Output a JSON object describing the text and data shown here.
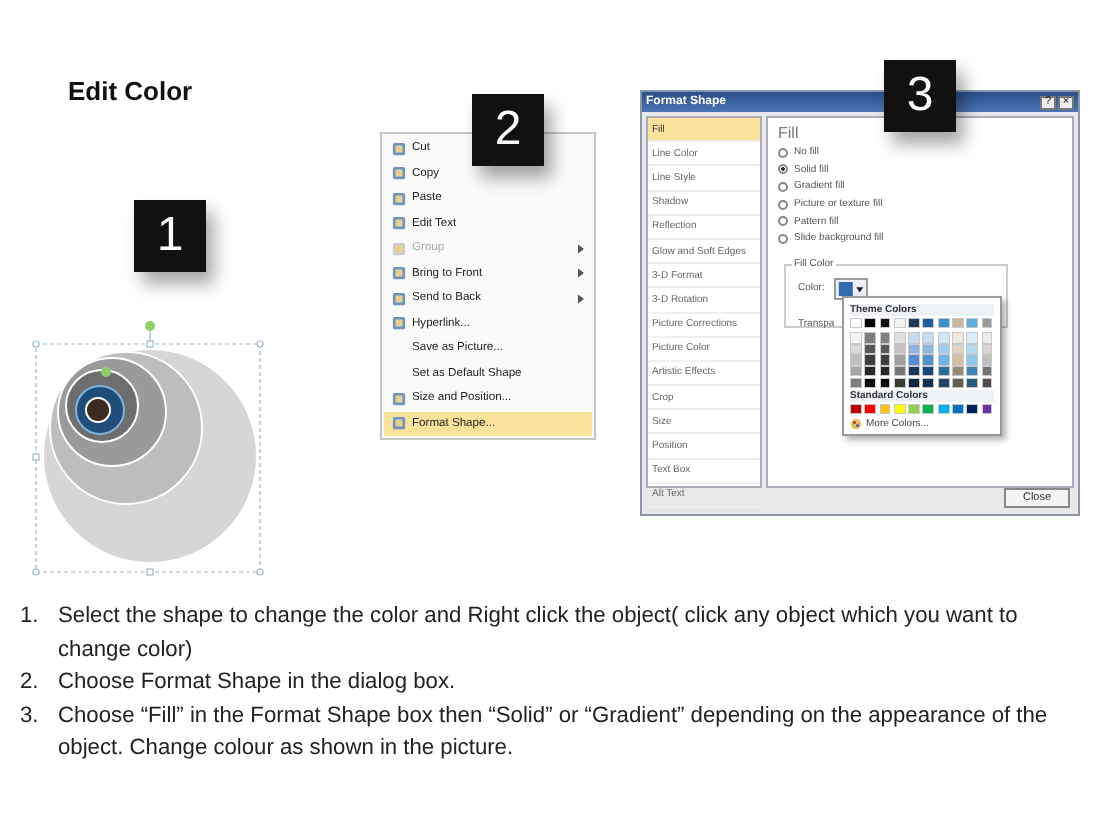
{
  "title": "Edit Color",
  "step_badges": [
    "1",
    "2",
    "3"
  ],
  "context_menu": {
    "items": [
      {
        "label": "Cut",
        "kind": "with-icon",
        "disabled": false,
        "submenu": false,
        "selected": false
      },
      {
        "label": "Copy",
        "kind": "with-icon",
        "disabled": false,
        "submenu": false,
        "selected": false
      },
      {
        "label": "Paste",
        "kind": "with-icon",
        "disabled": false,
        "submenu": false,
        "selected": false
      },
      {
        "label": "Edit Text",
        "kind": "with-icon",
        "disabled": false,
        "submenu": false,
        "selected": false
      },
      {
        "label": "Group",
        "kind": "with-icon",
        "disabled": true,
        "submenu": true,
        "selected": false
      },
      {
        "label": "Bring to Front",
        "kind": "with-icon",
        "disabled": false,
        "submenu": true,
        "selected": false
      },
      {
        "label": "Send to Back",
        "kind": "with-icon",
        "disabled": false,
        "submenu": true,
        "selected": false
      },
      {
        "label": "Hyperlink...",
        "kind": "with-icon",
        "disabled": false,
        "submenu": false,
        "selected": false
      },
      {
        "label": "Save as Picture...",
        "kind": "plain",
        "disabled": false,
        "submenu": false,
        "selected": false
      },
      {
        "label": "Set as Default Shape",
        "kind": "plain",
        "disabled": false,
        "submenu": false,
        "selected": false
      },
      {
        "label": "Size and Position...",
        "kind": "with-icon",
        "disabled": false,
        "submenu": false,
        "selected": false
      },
      {
        "label": "Format Shape...",
        "kind": "with-icon",
        "disabled": false,
        "submenu": false,
        "selected": true
      }
    ]
  },
  "format_shape": {
    "title": "Format Shape",
    "help": "?",
    "close_x": "×",
    "categories": [
      {
        "label": "Fill",
        "selected": true
      },
      {
        "label": "Line Color",
        "selected": false
      },
      {
        "label": "Line Style",
        "selected": false
      },
      {
        "label": "Shadow",
        "selected": false
      },
      {
        "label": "Reflection",
        "selected": false
      },
      {
        "label": "Glow and Soft Edges",
        "selected": false
      },
      {
        "label": "3-D Format",
        "selected": false
      },
      {
        "label": "3-D Rotation",
        "selected": false
      },
      {
        "label": "Picture Corrections",
        "selected": false
      },
      {
        "label": "Picture Color",
        "selected": false
      },
      {
        "label": "Artistic Effects",
        "selected": false
      },
      {
        "label": "Crop",
        "selected": false
      },
      {
        "label": "Size",
        "selected": false
      },
      {
        "label": "Position",
        "selected": false
      },
      {
        "label": "Text Box",
        "selected": false
      },
      {
        "label": "Alt Text",
        "selected": false
      }
    ],
    "heading": "Fill",
    "fill_options": [
      {
        "label": "No fill",
        "selected": false
      },
      {
        "label": "Solid fill",
        "selected": true
      },
      {
        "label": "Gradient fill",
        "selected": false
      },
      {
        "label": "Picture or texture fill",
        "selected": false
      },
      {
        "label": "Pattern fill",
        "selected": false
      },
      {
        "label": "Slide background fill",
        "selected": false
      }
    ],
    "group_label": "Fill Color",
    "color_label": "Color:",
    "transparency_label": "Transpa",
    "palette": {
      "theme_title": "Theme Colors",
      "theme_rows": [
        [
          {
            "color": "#ffffff"
          },
          {
            "color": "#000000"
          },
          {
            "color": "#111111"
          },
          {
            "color": "#f2f2f2"
          },
          {
            "color": "#1f3b5a"
          },
          {
            "color": "#1f5fa0"
          },
          {
            "color": "#3a8fd0"
          },
          {
            "color": "#c8b8a0"
          },
          {
            "color": "#5aaee0"
          },
          {
            "color": "#9a9a9a"
          }
        ],
        [
          {
            "color": "#f2f2f2"
          },
          {
            "color": "#7f7f7f"
          },
          {
            "color": "#808080"
          },
          {
            "color": "#e0e0e0"
          },
          {
            "color": "#c6d9f1"
          },
          {
            "color": "#c5dbf0"
          },
          {
            "color": "#cfe6f7"
          },
          {
            "color": "#efe9e0"
          },
          {
            "color": "#d8edf8"
          },
          {
            "color": "#ebebeb"
          }
        ],
        [
          {
            "color": "#d9d9d9"
          },
          {
            "color": "#595959"
          },
          {
            "color": "#5a5a5a"
          },
          {
            "color": "#c4c4c4"
          },
          {
            "color": "#8db3e2"
          },
          {
            "color": "#8cb7e0"
          },
          {
            "color": "#9fcdef"
          },
          {
            "color": "#dfd4c2"
          },
          {
            "color": "#b2dbf1"
          },
          {
            "color": "#d6d6d6"
          }
        ],
        [
          {
            "color": "#bfbfbf"
          },
          {
            "color": "#3f3f3f"
          },
          {
            "color": "#404040"
          },
          {
            "color": "#a0a0a0"
          },
          {
            "color": "#548dd4"
          },
          {
            "color": "#5393d0"
          },
          {
            "color": "#6fb4e7"
          },
          {
            "color": "#cfbfa4"
          },
          {
            "color": "#8bc9ea"
          },
          {
            "color": "#c0c0c0"
          }
        ],
        [
          {
            "color": "#a6a6a6"
          },
          {
            "color": "#262626"
          },
          {
            "color": "#272727"
          },
          {
            "color": "#757575"
          },
          {
            "color": "#17365d"
          },
          {
            "color": "#17477a"
          },
          {
            "color": "#2a6b9c"
          },
          {
            "color": "#968a78"
          },
          {
            "color": "#3a86b8"
          },
          {
            "color": "#737373"
          }
        ],
        [
          {
            "color": "#7f7f7f"
          },
          {
            "color": "#0c0c0c"
          },
          {
            "color": "#0d0d0d"
          },
          {
            "color": "#3a3a3a"
          },
          {
            "color": "#0f243e"
          },
          {
            "color": "#0f2f51"
          },
          {
            "color": "#1c4768"
          },
          {
            "color": "#645c50"
          },
          {
            "color": "#26597a"
          },
          {
            "color": "#4d4d4d"
          }
        ]
      ],
      "standard_title": "Standard Colors",
      "standard": [
        {
          "color": "#c00000"
        },
        {
          "color": "#ff0000"
        },
        {
          "color": "#ffc000"
        },
        {
          "color": "#ffff00"
        },
        {
          "color": "#92d050"
        },
        {
          "color": "#00b050"
        },
        {
          "color": "#00b0f0"
        },
        {
          "color": "#0070c0"
        },
        {
          "color": "#002060"
        },
        {
          "color": "#7030a0"
        }
      ],
      "more": "More Colors..."
    },
    "close": "Close"
  },
  "instructions": [
    {
      "number": "1.",
      "text": "Select the shape to change the color and Right click the object( click any object which you want to change color)"
    },
    {
      "number": "2.",
      "text": "Choose Format Shape in the dialog box."
    },
    {
      "number": "3.",
      "text": "Choose “Fill” in the Format Shape box then “Solid” or “Gradient” depending on the appearance of the object. Change colour as shown in the picture."
    }
  ]
}
